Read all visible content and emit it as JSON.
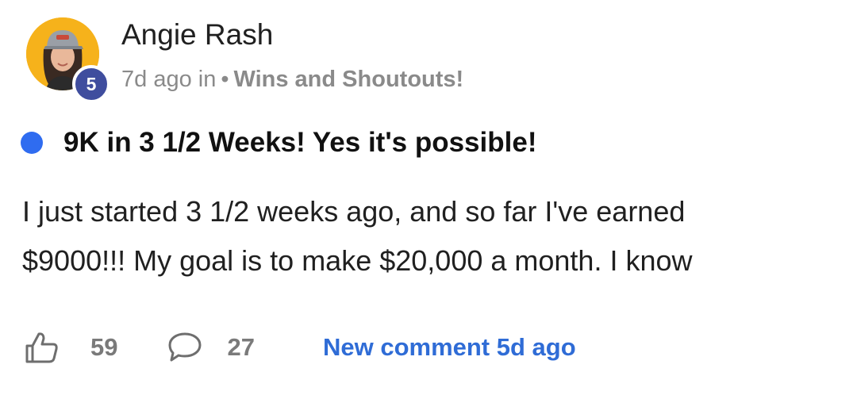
{
  "author": {
    "name": "Angie Rash",
    "level": "5"
  },
  "meta": {
    "time": "7d ago in",
    "separator": "•",
    "category": "Wins and Shoutouts!"
  },
  "post": {
    "title": "9K in 3 1/2 Weeks! Yes it's possible!",
    "body_line_1": "I just started 3 1/2 weeks ago, and so far I've earned",
    "body_line_2": "$9000!!! My goal is to make $20,000 a month. I know"
  },
  "footer": {
    "like_count": "59",
    "comment_count": "27",
    "new_comment_label": "New comment 5d ago"
  },
  "icons": {
    "like": "thumbs-up-icon",
    "comment": "speech-bubble-icon",
    "unread": "unread-dot-icon"
  },
  "colors": {
    "avatar_bg": "#f6b21b",
    "badge_bg": "#3f4d9e",
    "unread_dot": "#2f6cf0",
    "link": "#2f6cd6",
    "muted": "#8a8a8a"
  }
}
